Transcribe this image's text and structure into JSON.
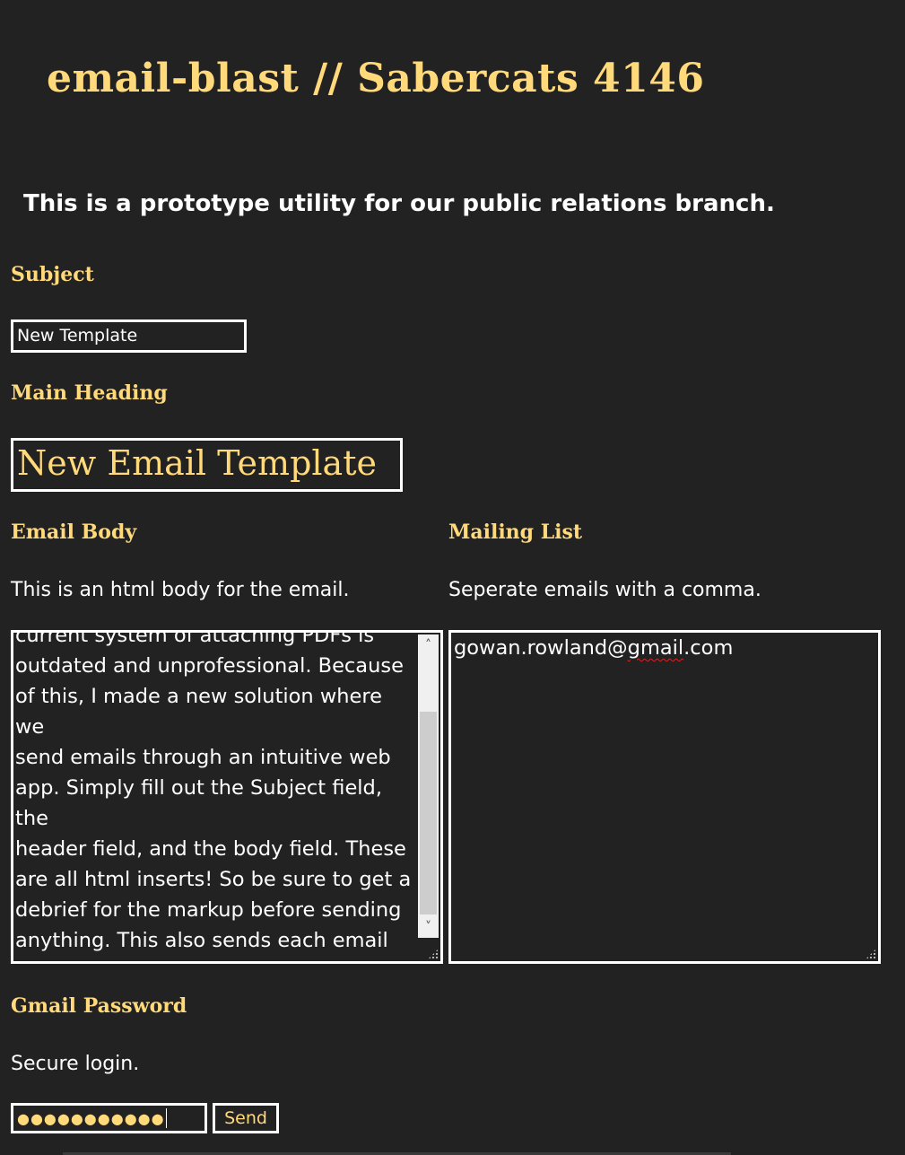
{
  "app_title": "email-blast // Sabercats 4146",
  "intro": "This is a prototype utility for our public relations branch.",
  "subject": {
    "label": "Subject",
    "value": "New Template"
  },
  "main_heading": {
    "label": "Main Heading",
    "value": "New Email Template"
  },
  "email_body": {
    "label": "Email Body",
    "help": "This is an html body for the email.",
    "value": "current system of attaching PDFs is\noutdated and unprofessional. Because\nof this, I made a new solution where we\nsend emails through an intuitive web\napp. Simply fill out the Subject field, the\nheader field, and the body field. These\nare all html inserts! So be sure to get a\ndebrief for the markup before sending\nanything. This also sends each email\nindividually! It has all of our native\nbranding and logos.",
    "scroll_position_fraction": 0.75
  },
  "mailing_list": {
    "label": "Mailing List",
    "help": "Seperate emails with a comma.",
    "value_prefix": "gowan.rowland@",
    "value_misspelled": "gmail",
    "value_suffix": ".com"
  },
  "gmail_password": {
    "label": "Gmail Password",
    "help": "Secure login.",
    "masked_value": "●●●●●●●●●●●"
  },
  "send_button": {
    "label": "Send"
  },
  "colors": {
    "background": "#222222",
    "accent": "#ffd97a",
    "text": "#ffffff",
    "border": "#ffffff"
  },
  "icons": {
    "scroll_up": "chevron-up-icon",
    "scroll_down": "chevron-down-icon",
    "resize": "resize-grip-icon"
  }
}
